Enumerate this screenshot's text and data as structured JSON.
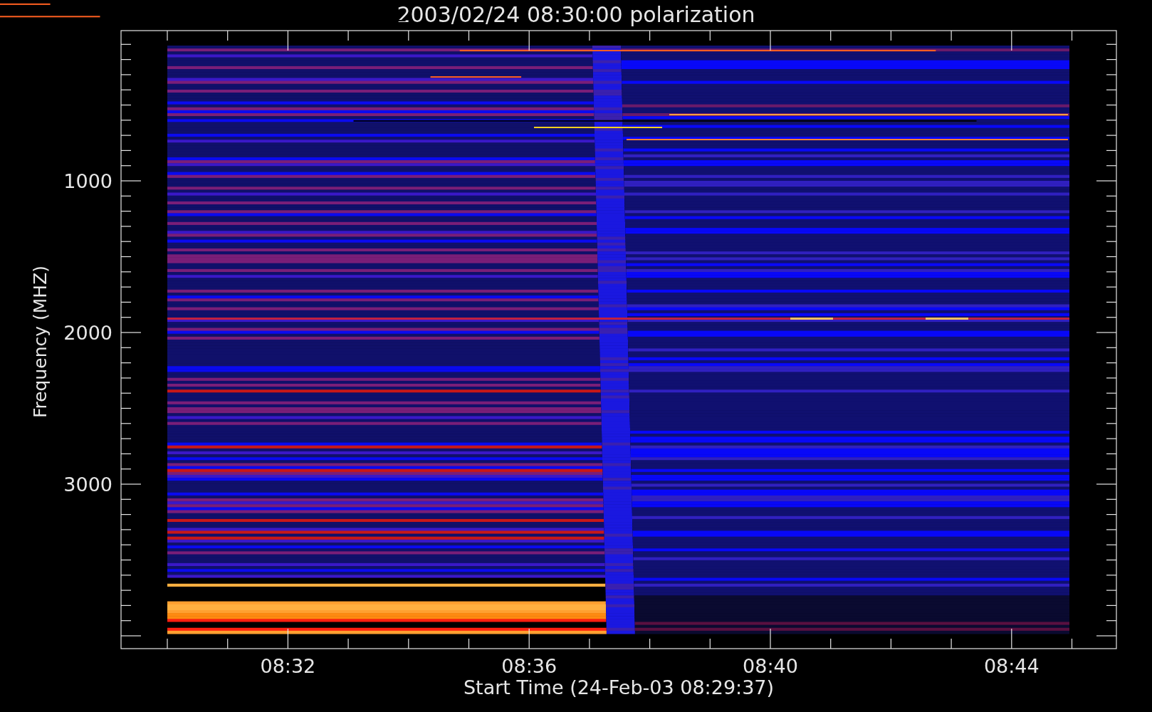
{
  "title": "2003/02/24 08:30:00 polarization",
  "y_axis": {
    "label": "Frequency (MHZ)",
    "ticks": [
      "1000",
      "2000",
      "3000"
    ]
  },
  "x_axis": {
    "label": "Start Time (24-Feb-03 08:29:37)",
    "ticks": [
      "08:32",
      "08:36",
      "08:40",
      "08:44"
    ]
  }
}
